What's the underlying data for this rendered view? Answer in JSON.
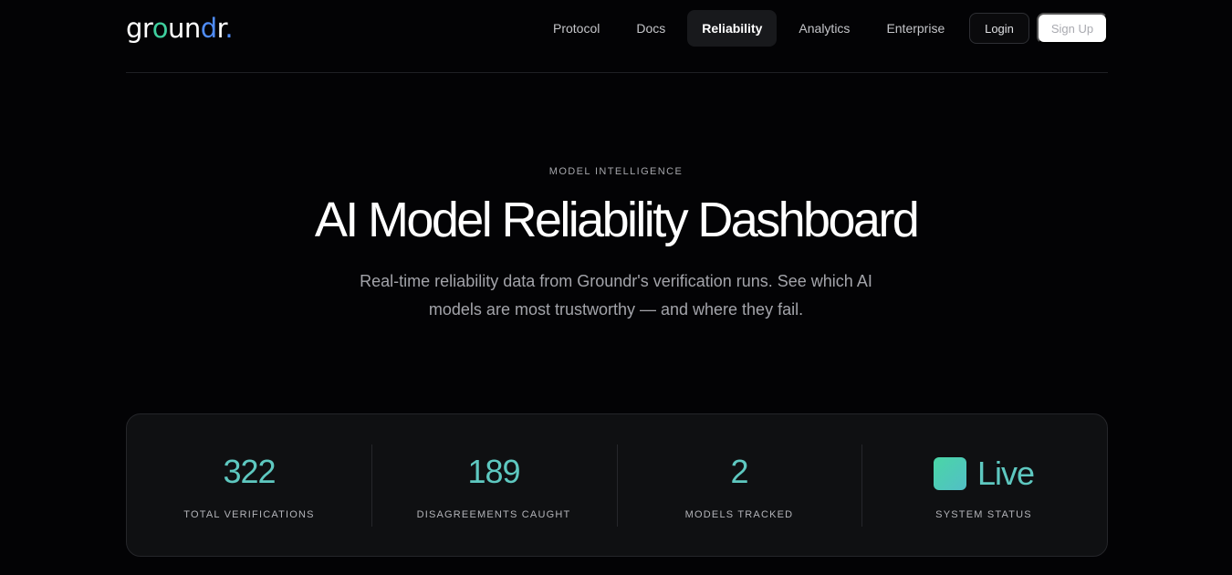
{
  "brand": {
    "logo_text": "groundr",
    "logo_dot": "."
  },
  "nav": {
    "items": [
      {
        "label": "Protocol"
      },
      {
        "label": "Docs"
      },
      {
        "label": "Reliability",
        "active": true
      },
      {
        "label": "Analytics"
      },
      {
        "label": "Enterprise"
      }
    ],
    "login_label": "Login",
    "signup_label": "Sign Up"
  },
  "hero": {
    "eyebrow": "MODEL INTELLIGENCE",
    "title": "AI Model Reliability Dashboard",
    "subtitle": "Real-time reliability data from Groundr's verification runs. See which AI models are most trustworthy — and where they fail."
  },
  "stats": [
    {
      "value": "322",
      "label": "TOTAL VERIFICATIONS"
    },
    {
      "value": "189",
      "label": "DISAGREEMENTS CAUGHT"
    },
    {
      "value": "2",
      "label": "MODELS TRACKED"
    },
    {
      "value": "Live",
      "label": "SYSTEM STATUS",
      "indicator": "status-square"
    }
  ],
  "colors": {
    "accent": "#5ec8c0",
    "logo_o": "#3ecf9e",
    "logo_d": "#4f8cf7",
    "background": "#030305",
    "panel": "#0f1012"
  }
}
